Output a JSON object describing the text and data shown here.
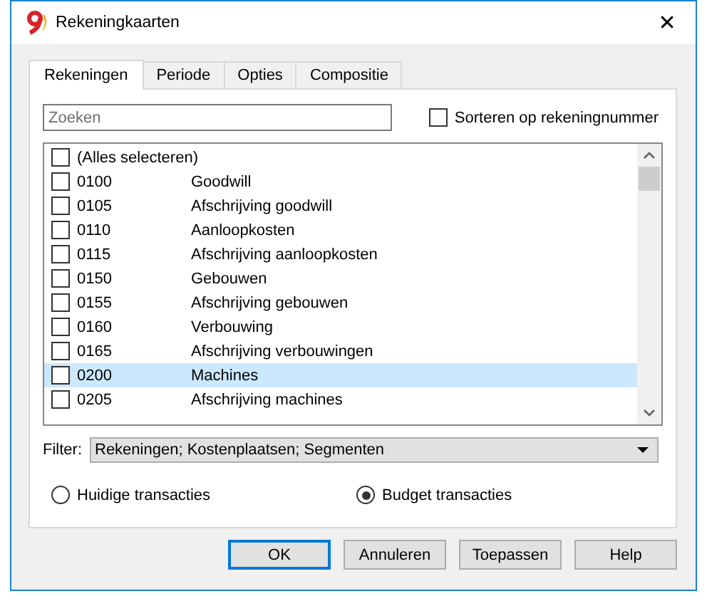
{
  "window": {
    "title": "Rekeningkaarten",
    "close": "✕"
  },
  "tabs": [
    {
      "label": "Rekeningen",
      "selected": true
    },
    {
      "label": "Periode",
      "selected": false
    },
    {
      "label": "Opties",
      "selected": false
    },
    {
      "label": "Compositie",
      "selected": false
    }
  ],
  "search": {
    "placeholder": "Zoeken"
  },
  "sort_option": {
    "label": "Sorteren op rekeningnummer",
    "checked": false
  },
  "select_all": {
    "label": "(Alles selecteren)",
    "checked": false
  },
  "accounts": [
    {
      "code": "0100",
      "name": "Goodwill",
      "checked": false,
      "selected": false
    },
    {
      "code": "0105",
      "name": "Afschrijving goodwill",
      "checked": false,
      "selected": false
    },
    {
      "code": "0110",
      "name": "Aanloopkosten",
      "checked": false,
      "selected": false
    },
    {
      "code": "0115",
      "name": "Afschrijving aanloopkosten",
      "checked": false,
      "selected": false
    },
    {
      "code": "0150",
      "name": "Gebouwen",
      "checked": false,
      "selected": false
    },
    {
      "code": "0155",
      "name": "Afschrijving gebouwen",
      "checked": false,
      "selected": false
    },
    {
      "code": "0160",
      "name": "Verbouwing",
      "checked": false,
      "selected": false
    },
    {
      "code": "0165",
      "name": "Afschrijving verbouwingen",
      "checked": false,
      "selected": false
    },
    {
      "code": "0200",
      "name": "Machines",
      "checked": false,
      "selected": true
    },
    {
      "code": "0205",
      "name": "Afschrijving machines",
      "checked": false,
      "selected": false
    }
  ],
  "filter": {
    "label": "Filter:",
    "value": "Rekeningen; Kostenplaatsen; Segmenten"
  },
  "transactions": [
    {
      "label": "Huidige transacties",
      "selected": false
    },
    {
      "label": "Budget transacties",
      "selected": true
    }
  ],
  "buttons": [
    {
      "label": "OK",
      "default": true
    },
    {
      "label": "Annuleren",
      "default": false
    },
    {
      "label": "Toepassen",
      "default": false
    },
    {
      "label": "Help",
      "default": false
    }
  ]
}
